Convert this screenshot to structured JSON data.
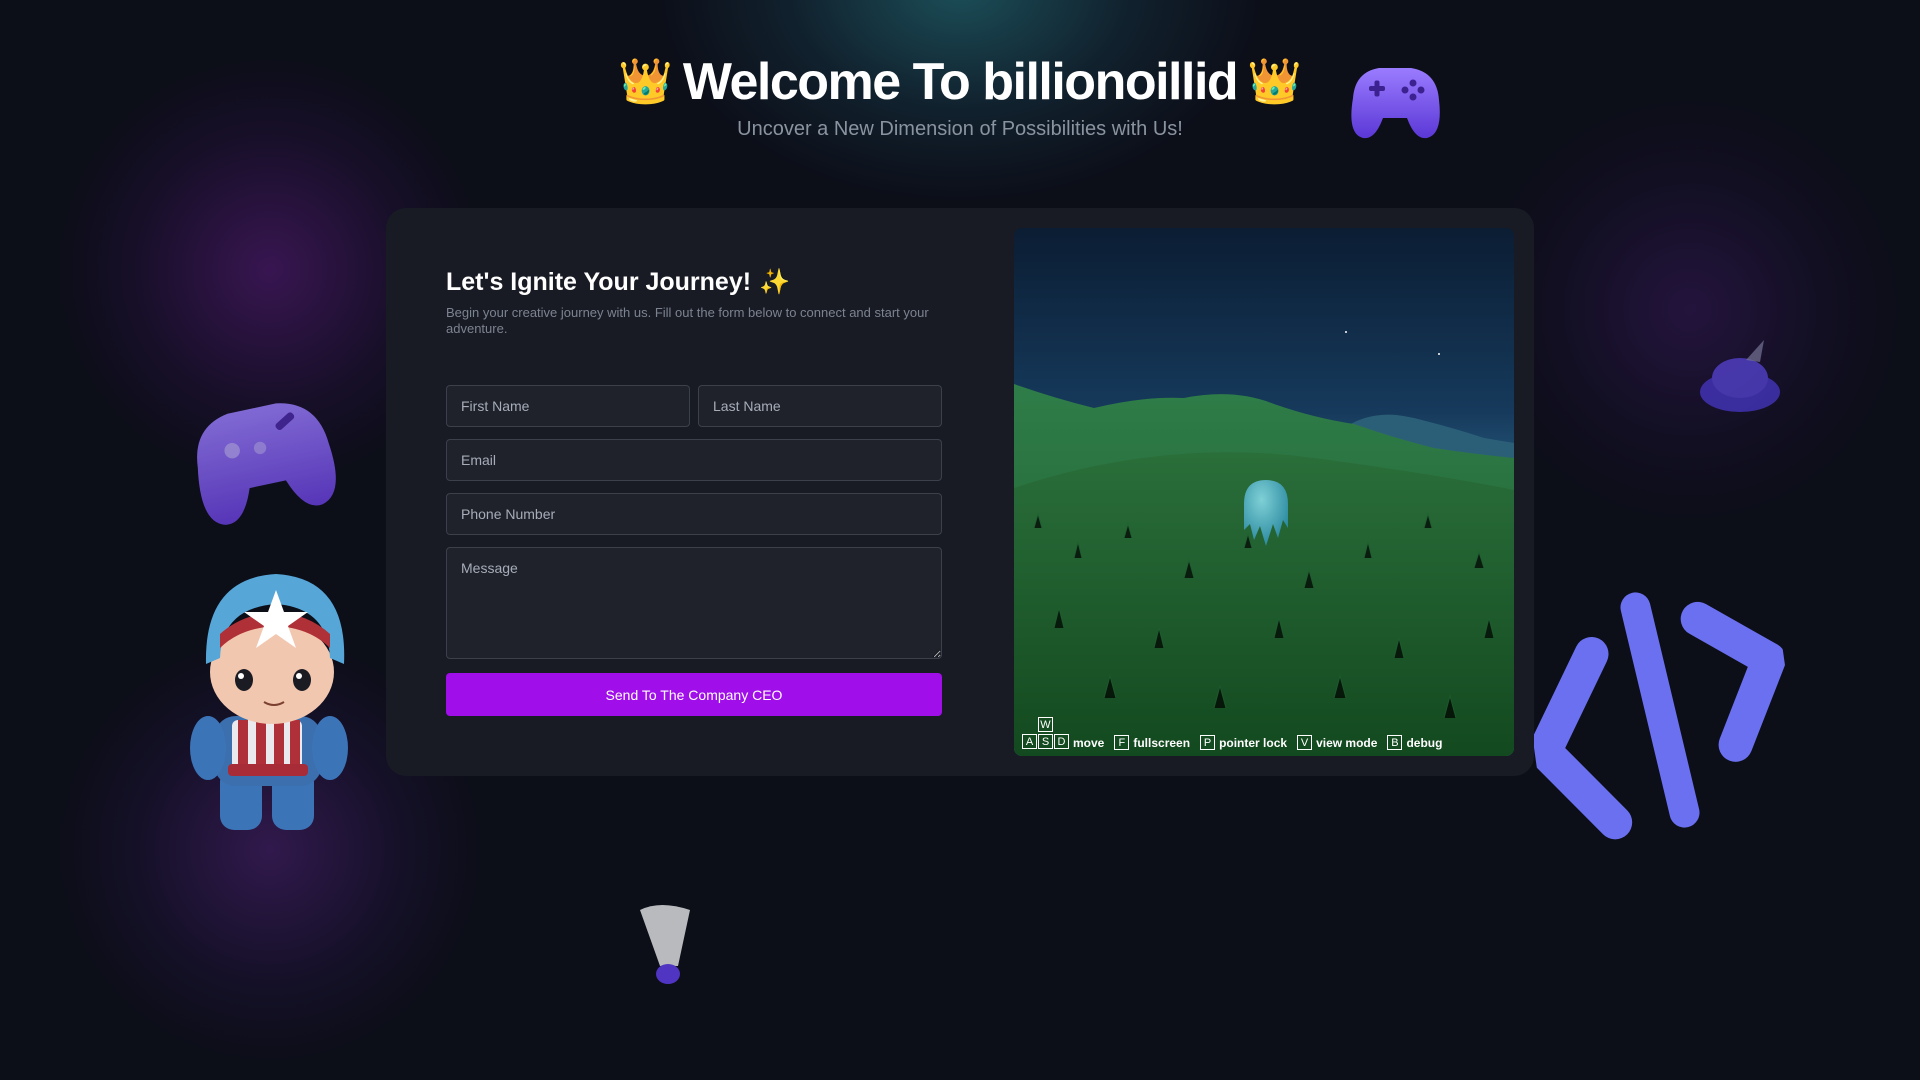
{
  "header": {
    "title": "Welcome To billionoillid",
    "subtitle": "Uncover a New Dimension of Possibilities with Us!",
    "crown_icon": "👑"
  },
  "form": {
    "title": "Let's Ignite Your Journey!",
    "title_icon": "✨",
    "description": "Begin your creative journey with us. Fill out the form below to connect and start your adventure.",
    "first_name_placeholder": "First Name",
    "last_name_placeholder": "Last Name",
    "email_placeholder": "Email",
    "phone_placeholder": "Phone Number",
    "message_placeholder": "Message",
    "submit_label": "Send To The Company CEO"
  },
  "scene": {
    "controls": {
      "keys_move": [
        "W",
        "A",
        "S",
        "D"
      ],
      "move_label": "move",
      "fullscreen_key": "F",
      "fullscreen_label": "fullscreen",
      "pointer_key": "P",
      "pointer_label": "pointer lock",
      "view_key": "V",
      "view_label": "view mode",
      "debug_key": "B",
      "debug_label": "debug"
    }
  },
  "colors": {
    "background": "#0c0e18",
    "panel": "#181b24",
    "accent_button": "#a00eea",
    "gamepad": "#7b5cf0",
    "code_icon": "#6d74f0"
  },
  "decorations": [
    "gamepad-icon",
    "gamepad-icon",
    "hat-icon",
    "hero-character",
    "code-icon",
    "shuttlecock-icon"
  ]
}
